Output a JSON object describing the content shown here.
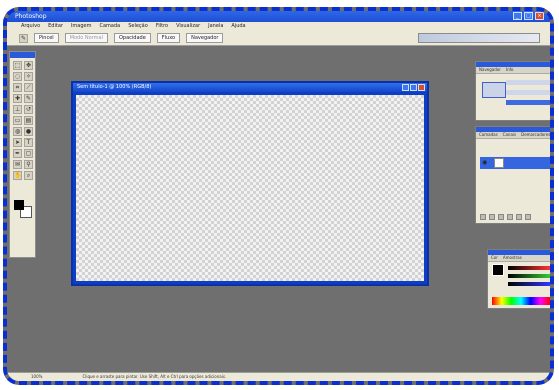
{
  "window": {
    "title": "Photoshop"
  },
  "menubar": {
    "items": [
      "Arquivo",
      "Editar",
      "Imagem",
      "Camada",
      "Seleção",
      "Filtro",
      "Visualizar",
      "Janela",
      "Ajuda"
    ]
  },
  "optionsbar": {
    "items": [
      {
        "label": "Pincel",
        "dim": false
      },
      {
        "label": "Modo Normal",
        "dim": true
      },
      {
        "label": "Opacidade",
        "dim": false
      },
      {
        "label": "Fluxo",
        "dim": false
      },
      {
        "label": "Navegador",
        "dim": false
      }
    ]
  },
  "document": {
    "title": "Sem título-1 @ 100% (RGB/8)"
  },
  "panels": {
    "navigator_tabs": [
      "Navegador",
      "Info"
    ],
    "layers_tabs": [
      "Camadas",
      "Canais",
      "Demarcadores"
    ],
    "color_tabs": [
      "Cor",
      "Amostras"
    ]
  },
  "status": {
    "zoom": "100%",
    "hint": "Clique e arraste para pintar. Use Shift, Alt e Ctrl para opções adicionais."
  },
  "colors": {
    "frame": "#0a2fd0",
    "workspace": "#6f6f6f",
    "chrome": "#ece9d8",
    "titlebar": "#1d4fd3"
  }
}
